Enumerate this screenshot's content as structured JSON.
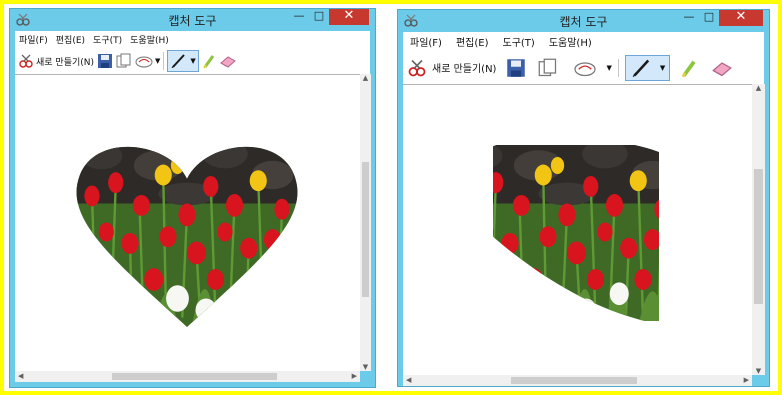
{
  "windows": [
    {
      "title": "캡처 도구",
      "menu": [
        "파일(F)",
        "편집(E)",
        "도구(T)",
        "도움말(H)"
      ],
      "new_snip_label": "새로 만들기(N)",
      "title_buttons": {
        "minimize": "—",
        "maximize": "□",
        "close": "✕"
      },
      "snip_shape": "heart"
    },
    {
      "title": "캡처 도구",
      "menu": [
        "파일(F)",
        "편집(E)",
        "도구(T)",
        "도움말(H)"
      ],
      "new_snip_label": "새로 만들기(N)",
      "title_buttons": {
        "minimize": "—",
        "maximize": "□",
        "close": "✕"
      },
      "snip_shape": "half-heart"
    }
  ],
  "colors": {
    "background_highlight": "#ffff00",
    "window_frame": "#6ccbe9",
    "close_button": "#c7392e",
    "tulip_red": "#d8141e",
    "tulip_yellow": "#f2c414",
    "foliage": "#4d7a2c"
  },
  "icons": [
    "snipping-tool-icon",
    "new-snip-icon",
    "save-icon",
    "copy-icon",
    "send-icon",
    "pen-icon",
    "highlighter-icon",
    "eraser-icon"
  ]
}
